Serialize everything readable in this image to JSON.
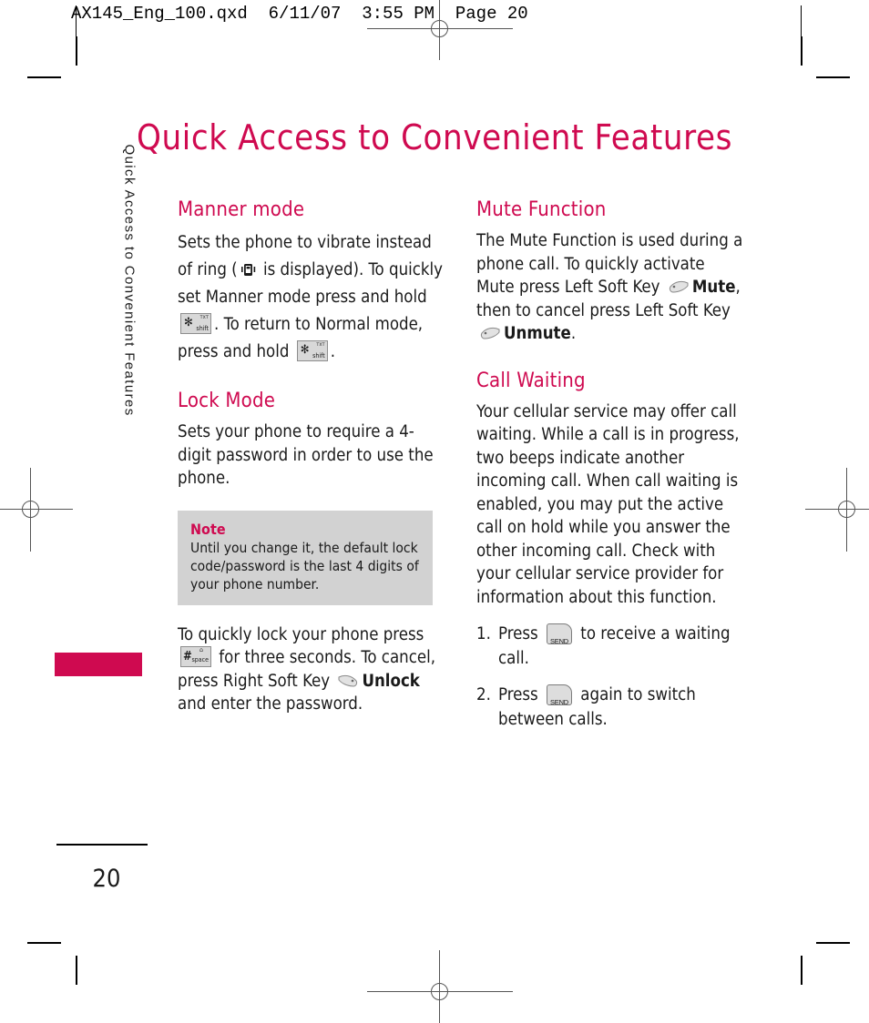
{
  "print_marks": {
    "header_imprint": "AX145_Eng_100.qxd  6/11/07  3:55 PM  Page 20"
  },
  "page": {
    "title": "Quick Access to Convenient Features",
    "number": "20",
    "side_tab_label": "Quick Access to Convenient Features",
    "accent_color": "#cf0a50",
    "note_bg_color": "#d2d2d2"
  },
  "left_column": {
    "manner_mode": {
      "heading": "Manner mode",
      "text_1": "Sets the phone to vibrate instead of ring (",
      "icon_1": "vibrate-icon",
      "text_2": " is displayed). To quickly set Manner mode press and hold ",
      "icon_2": "star-shift-key",
      "text_3": ". To return to Normal mode, press and hold ",
      "icon_3": "star-shift-key",
      "text_4": "."
    },
    "lock_mode": {
      "heading": "Lock Mode",
      "paragraph": "Sets your phone to require a 4-digit password in order to use the phone.",
      "note": {
        "title": "Note",
        "body": "Until you change it, the default lock code/password is the last 4 digits of your phone number."
      },
      "text_1": "To quickly lock your phone press ",
      "icon_1": "hash-space-key",
      "text_2": " for three seconds. To cancel, press Right Soft Key ",
      "icon_2": "right-soft-key",
      "bold_1": "Unlock",
      "text_3": " and enter the password."
    }
  },
  "right_column": {
    "mute_function": {
      "heading": "Mute Function",
      "text_1": "The Mute Function is used during a phone call. To quickly activate Mute press Left Soft Key ",
      "icon_1": "left-soft-key",
      "bold_1": "Mute",
      "text_2": ", then to cancel press Left Soft Key ",
      "icon_2": "left-soft-key",
      "bold_2": "Unmute",
      "text_3": "."
    },
    "call_waiting": {
      "heading": "Call Waiting",
      "paragraph": "Your cellular service may offer call waiting. While a call is in progress, two beeps indicate another incoming call. When call waiting is enabled, you may put the active call on hold while you answer the other incoming call. Check with your cellular service provider for information about this function.",
      "steps": [
        {
          "num": "1.",
          "text_before": "Press ",
          "icon": "send-key",
          "icon_label": "SEND",
          "text_after": " to receive a waiting call."
        },
        {
          "num": "2.",
          "text_before": "Press ",
          "icon": "send-key",
          "icon_label": "SEND",
          "text_after": " again to switch between calls."
        }
      ]
    }
  },
  "keys": {
    "star_shift": {
      "main": "✻",
      "sub": "ᴛxᴛ",
      "sub2": "shift"
    },
    "hash_space": {
      "main": "#",
      "sub": "⌂",
      "sub2": "space"
    }
  }
}
